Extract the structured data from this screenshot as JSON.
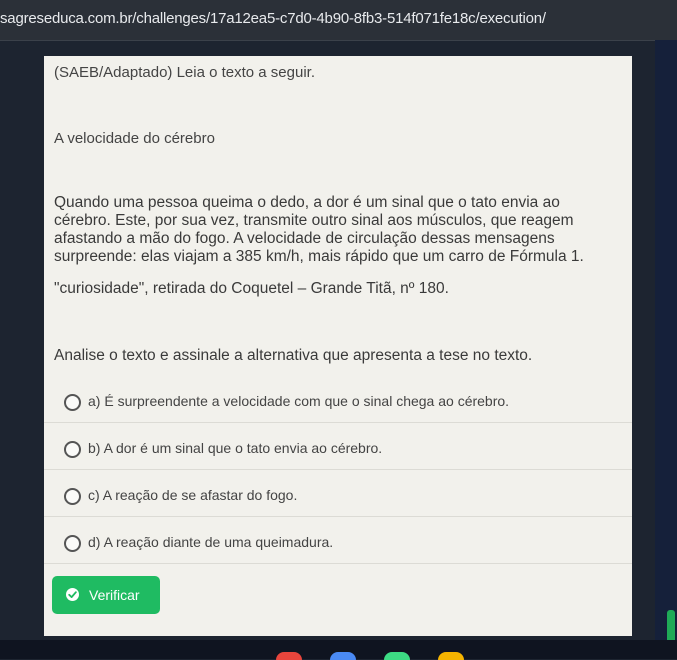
{
  "browser": {
    "url": "sagreseduca.com.br/challenges/17a12ea5-c7d0-4b90-8fb3-514f071fe18c/execution/"
  },
  "content": {
    "header": "(SAEB/Adaptado) Leia o texto a seguir.",
    "title": "A velocidade do cérebro",
    "passage_lines": [
      "Quando uma pessoa queima o dedo, a dor é um sinal que o tato envia ao",
      "cérebro. Este, por sua vez, transmite outro sinal aos músculos, que reagem",
      "afastando a mão do fogo. A velocidade de circulação dessas mensagens",
      "surpreende: elas viajam a 385 km/h, mais rápido que um carro de Fórmula 1."
    ],
    "source": "\"curiosidade\", retirada do Coquetel – Grande Titã, nº 180.",
    "question": "Analise o texto e assinale a alternativa que apresenta a tese no texto."
  },
  "options": [
    {
      "label": "a) É surpreendente a velocidade com que o sinal chega ao cérebro."
    },
    {
      "label": "b) A dor é um sinal que o tato envia ao cérebro."
    },
    {
      "label": "c) A reação de se afastar do fogo."
    },
    {
      "label": "d) A reação diante de uma queimadura."
    }
  ],
  "verify_button": {
    "label": "Verificar",
    "icon": "check-circle-icon",
    "color": "#1fbb62"
  },
  "taskbar": {
    "icons": [
      {
        "name": "chrome-icon",
        "color": "#e8453c"
      },
      {
        "name": "docs-icon",
        "color": "#4a8af4"
      },
      {
        "name": "play-store-icon",
        "color": "#3ddc84"
      },
      {
        "name": "classroom-icon",
        "color": "#f6b400"
      }
    ]
  }
}
